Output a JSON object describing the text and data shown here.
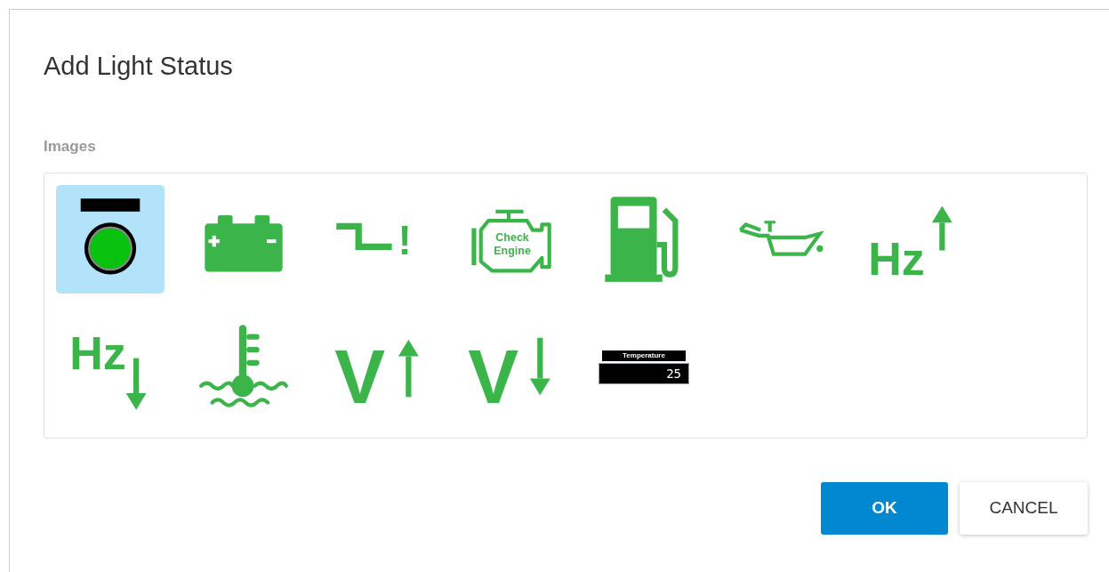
{
  "dialog": {
    "title": "Add Light Status"
  },
  "images_label": "Images",
  "images": [
    {
      "kind": "indicator-light",
      "selected": true
    },
    {
      "kind": "battery",
      "selected": false
    },
    {
      "kind": "low-level",
      "selected": false,
      "text": "!"
    },
    {
      "kind": "check-engine",
      "selected": false,
      "lines": [
        "Check",
        "Engine"
      ]
    },
    {
      "kind": "fuel",
      "selected": false
    },
    {
      "kind": "oil",
      "selected": false
    },
    {
      "kind": "frequency-up",
      "selected": false,
      "text": "Hz"
    },
    {
      "kind": "frequency-down",
      "selected": false,
      "text": "Hz"
    },
    {
      "kind": "coolant",
      "selected": false
    },
    {
      "kind": "voltage-up",
      "selected": false,
      "text": "V"
    },
    {
      "kind": "voltage-down",
      "selected": false,
      "text": "V"
    },
    {
      "kind": "temperature-display",
      "selected": false,
      "label": "Temperature",
      "value": "25"
    }
  ],
  "buttons": [
    {
      "kind": "primary",
      "label": "OK"
    },
    {
      "kind": "secondary",
      "label": "CANCEL"
    }
  ]
}
